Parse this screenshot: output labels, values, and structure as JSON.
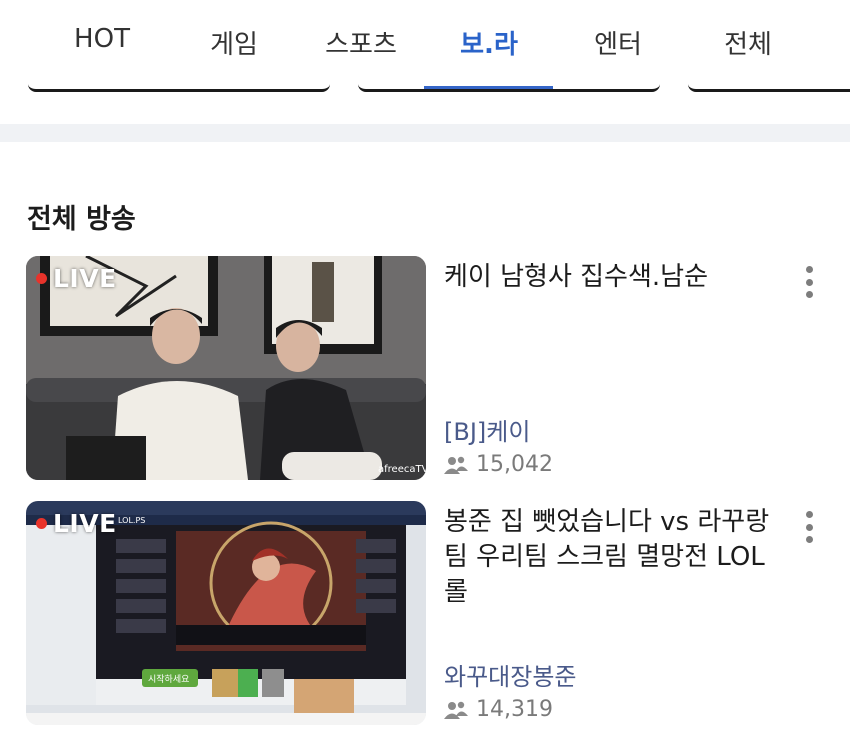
{
  "tabs": [
    {
      "label": "HOT",
      "active": false
    },
    {
      "label": "게임",
      "active": false
    },
    {
      "label": "스포츠",
      "active": false
    },
    {
      "label": "보.라",
      "active": true
    },
    {
      "label": "엔터",
      "active": false
    },
    {
      "label": "전체",
      "active": false
    }
  ],
  "section": {
    "title": "전체 방송"
  },
  "streams": [
    {
      "live_label": "LIVE",
      "title": "케이 남형사 집수색.남순",
      "channel": "[BJ]케이",
      "viewers": "15,042",
      "watermark": "afreecaTV"
    },
    {
      "live_label": "LIVE",
      "title": "봉준 집 뺏었습니다 vs 라꾸랑팀 우리팀 스크림 멸망전 LOL 롤",
      "channel": "와꾸대장봉준",
      "viewers": "14,319",
      "screen_text": {
        "app": "LOL.PS",
        "start_button": "시작하세요"
      }
    }
  ],
  "colors": {
    "accent": "#3566c8",
    "live_dot": "#e8332b",
    "channel": "#4a5a8a"
  },
  "icons": {
    "more": "kebab-more-icon",
    "viewers": "people-icon"
  }
}
